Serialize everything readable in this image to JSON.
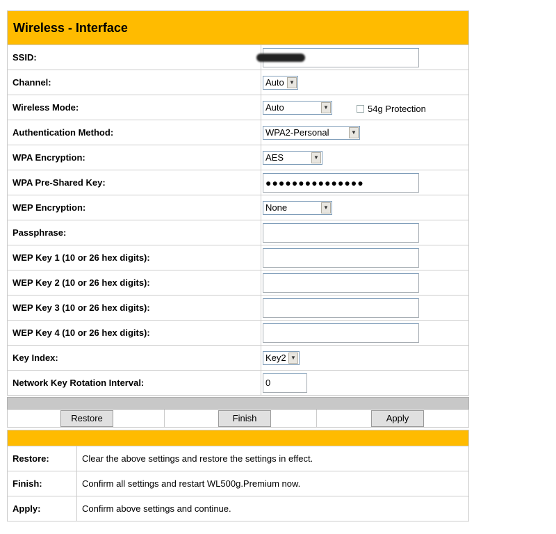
{
  "header": {
    "title": "Wireless - Interface"
  },
  "fields": {
    "ssid": {
      "label": "SSID:",
      "value": ""
    },
    "channel": {
      "label": "Channel:",
      "value": "Auto"
    },
    "wireless_mode": {
      "label": "Wireless Mode:",
      "value": "Auto",
      "protection_label": "54g Protection"
    },
    "auth_method": {
      "label": "Authentication Method:",
      "value": "WPA2-Personal"
    },
    "wpa_encryption": {
      "label": "WPA Encryption:",
      "value": "AES"
    },
    "wpa_psk": {
      "label": "WPA Pre-Shared Key:",
      "value": "●●●●●●●●●●●●●●●"
    },
    "wep_encryption": {
      "label": "WEP Encryption:",
      "value": "None"
    },
    "passphrase": {
      "label": "Passphrase:",
      "value": ""
    },
    "wep_key1": {
      "label": "WEP Key 1 (10 or 26 hex digits):",
      "value": ""
    },
    "wep_key2": {
      "label": "WEP Key 2 (10 or 26 hex digits):",
      "value": ""
    },
    "wep_key3": {
      "label": "WEP Key 3 (10 or 26 hex digits):",
      "value": ""
    },
    "wep_key4": {
      "label": "WEP Key 4 (10 or 26 hex digits):",
      "value": ""
    },
    "key_index": {
      "label": "Key Index:",
      "value": "Key2"
    },
    "rotation": {
      "label": "Network Key Rotation Interval:",
      "value": "0"
    }
  },
  "buttons": {
    "restore": "Restore",
    "finish": "Finish",
    "apply": "Apply"
  },
  "descriptions": [
    {
      "label": "Restore:",
      "text": "Clear the above settings and restore the settings in effect."
    },
    {
      "label": "Finish:",
      "text": "Confirm all settings and restart WL500g.Premium now."
    },
    {
      "label": "Apply:",
      "text": "Confirm above settings and continue."
    }
  ],
  "colors": {
    "header": "#ffbb00",
    "bar": "#c8c8c8"
  }
}
